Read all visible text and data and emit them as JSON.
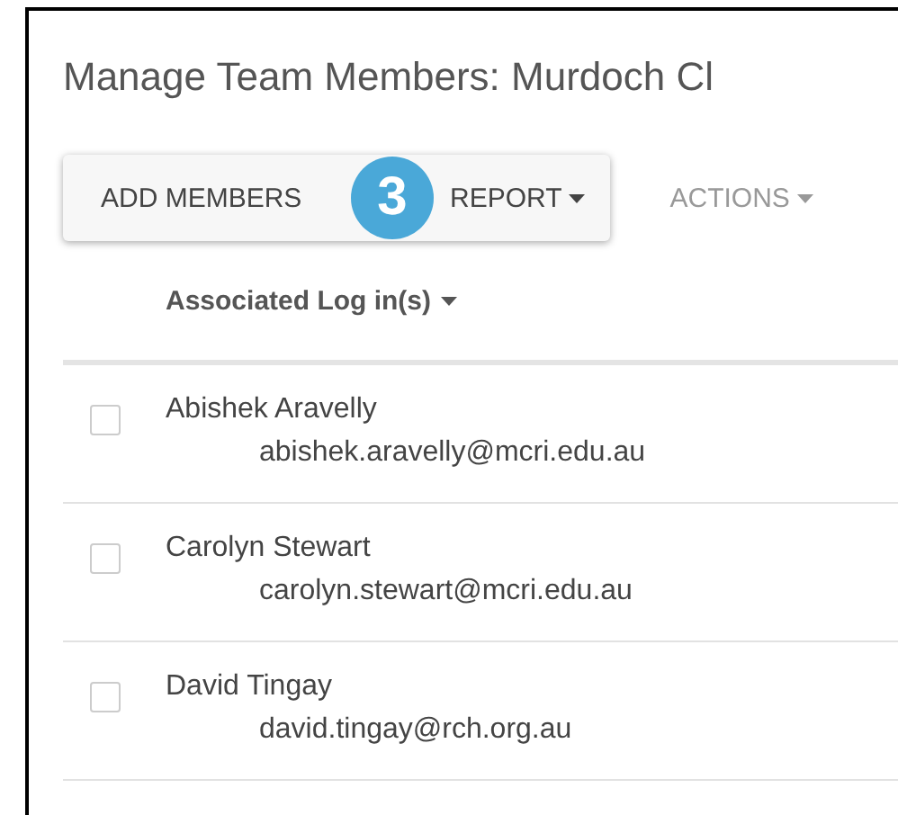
{
  "title": "Manage Team Members: Murdoch Cl",
  "toolbar": {
    "buttons": [
      {
        "label": "ADD MEMBERS",
        "dropdown": false
      },
      {
        "label": "REPORT",
        "dropdown": true
      }
    ],
    "actions": {
      "label": "ACTIONS",
      "dropdown": true
    }
  },
  "step_badge": "3",
  "table": {
    "column": {
      "label": "Associated Log in(s)",
      "sortable": true
    },
    "rows": [
      {
        "name": "Abishek Aravelly",
        "email": "abishek.aravelly@mcri.edu.au",
        "checked": false
      },
      {
        "name": "Carolyn Stewart",
        "email": "carolyn.stewart@mcri.edu.au",
        "checked": false
      },
      {
        "name": "David Tingay",
        "email": "david.tingay@rch.org.au",
        "checked": false
      }
    ]
  }
}
